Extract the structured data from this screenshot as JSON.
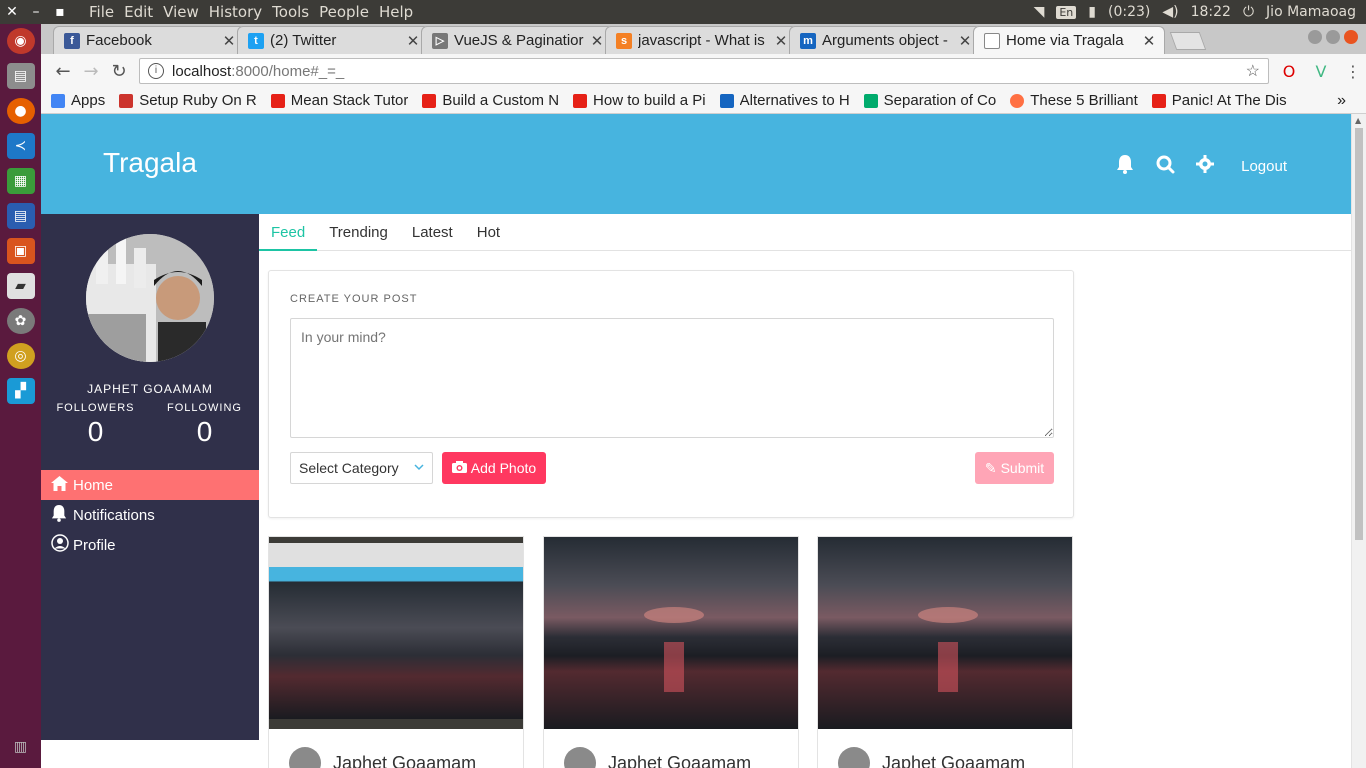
{
  "system": {
    "menus": [
      "File",
      "Edit",
      "View",
      "History",
      "Tools",
      "People",
      "Help"
    ],
    "keyboard": "En",
    "battery": "(0:23)",
    "time": "18:22",
    "user": "Jio Mamaoag"
  },
  "tabs": [
    {
      "title": "Facebook",
      "favicon_color": "#3b5998",
      "favicon_glyph": "f"
    },
    {
      "title": "(2) Twitter",
      "favicon_color": "#1da1f2",
      "favicon_glyph": "t"
    },
    {
      "title": "VueJS & Paginatior",
      "favicon_color": "#555555",
      "favicon_glyph": "▷"
    },
    {
      "title": "javascript - What is",
      "favicon_color": "#f48024",
      "favicon_glyph": "s"
    },
    {
      "title": "Arguments object -",
      "favicon_color": "#1565c0",
      "favicon_glyph": "m"
    },
    {
      "title": "Home via Tragala",
      "favicon_color": "#ffffff",
      "favicon_glyph": "",
      "active": true
    }
  ],
  "address": {
    "host": "localhost",
    "path": ":8000/home#_=_"
  },
  "bookmarks": [
    {
      "label": "Apps",
      "color": "#4285f4"
    },
    {
      "label": "Setup Ruby On R",
      "color": "#cc342d"
    },
    {
      "label": "Mean Stack Tutor",
      "color": "#e62117"
    },
    {
      "label": "Build a Custom N",
      "color": "#e62117"
    },
    {
      "label": "How to build a Pi",
      "color": "#e62117"
    },
    {
      "label": "Alternatives to H",
      "color": "#1565c0"
    },
    {
      "label": "Separation of Co",
      "color": "#00ab6c"
    },
    {
      "label": "These 5 Brilliant",
      "color": "#ff7043"
    },
    {
      "label": "Panic! At The Dis",
      "color": "#e62117"
    }
  ],
  "app": {
    "brand": "Tragala",
    "logout": "Logout",
    "colors": {
      "primary": "#47b4df",
      "sidebar": "#30304a",
      "active": "#fe7172",
      "accent": "#1dc4a4",
      "danger": "#ff3860"
    }
  },
  "profile": {
    "name": "JAPHET GOAAMAM",
    "followers_label": "FOLLOWERS",
    "followers": "0",
    "following_label": "FOLLOWING",
    "following": "0"
  },
  "sidebar": {
    "items": [
      {
        "label": "Home",
        "icon": "home-icon",
        "active": true
      },
      {
        "label": "Notifications",
        "icon": "bell-icon"
      },
      {
        "label": "Profile",
        "icon": "user-icon"
      }
    ]
  },
  "feed_tabs": [
    "Feed",
    "Trending",
    "Latest",
    "Hot"
  ],
  "create_post": {
    "caption": "CREATE YOUR POST",
    "placeholder": "In your mind?",
    "category": "Select Category",
    "add_photo": "Add Photo",
    "submit": "Submit"
  },
  "posts": [
    {
      "author": "Japhet Goaamam",
      "image": "screenshot"
    },
    {
      "author": "Japhet Goaamam",
      "image": "sunset"
    },
    {
      "author": "Japhet Goaamam",
      "image": "sunset"
    }
  ]
}
